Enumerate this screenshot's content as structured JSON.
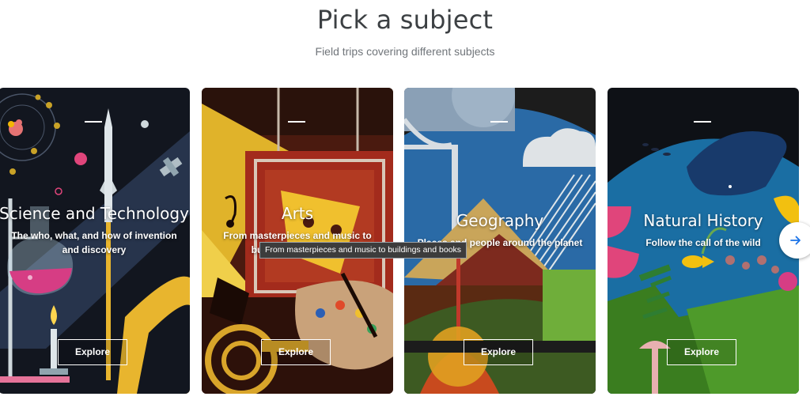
{
  "header": {
    "title": "Pick a subject",
    "subtitle": "Field trips covering different subjects"
  },
  "cards": [
    {
      "title": "Science and Technology",
      "description": "The who, what, and how of invention and discovery",
      "explore_label": "Explore"
    },
    {
      "title": "Arts",
      "description": "From masterpieces and music to buildings and books",
      "explore_label": "Explore"
    },
    {
      "title": "Geography",
      "description": "Places and people around the planet",
      "explore_label": "Explore"
    },
    {
      "title": "Natural History",
      "description": "Follow the call of the wild",
      "explore_label": "Explore"
    }
  ],
  "tooltip": {
    "text": "From masterpieces and music to buildings and books"
  },
  "next_button": {
    "icon": "arrow-right-icon",
    "color": "#1a73e8"
  },
  "colors": {
    "title": "#3c4043",
    "subtitle": "#70757a"
  }
}
